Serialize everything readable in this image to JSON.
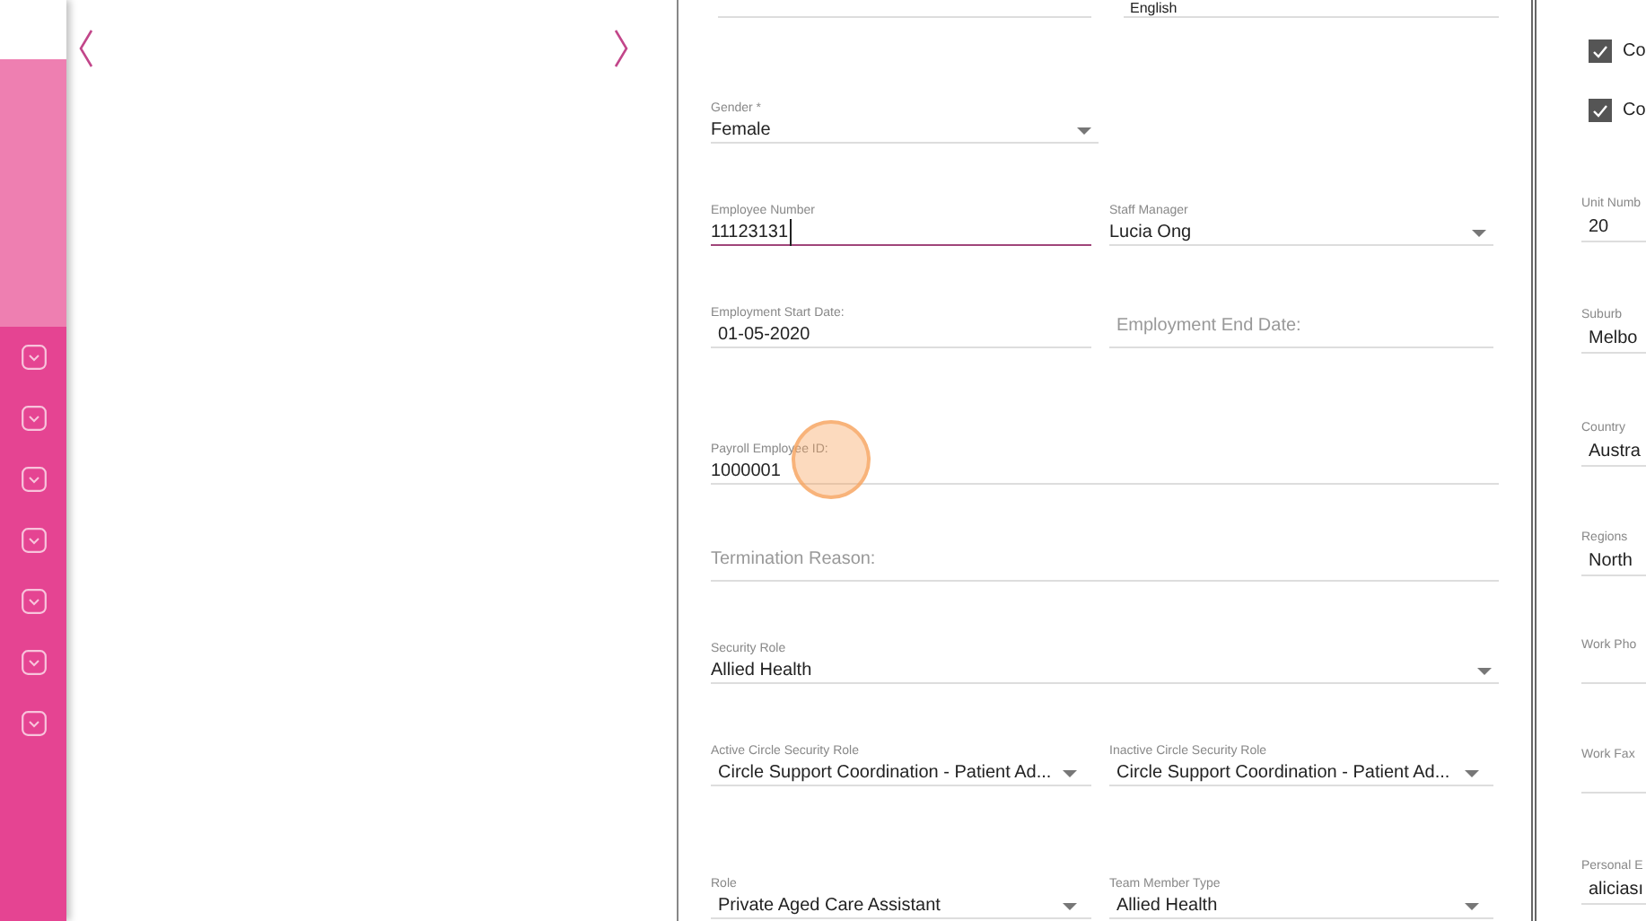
{
  "sidebar": {
    "items": [
      {
        "expanded": false
      },
      {
        "expanded": false
      },
      {
        "expanded": false
      },
      {
        "expanded": false
      },
      {
        "expanded": false
      },
      {
        "expanded": false
      },
      {
        "expanded": false
      }
    ]
  },
  "form": {
    "top_row_value": "English",
    "rows": [
      [
        {
          "kind": "select",
          "label": "Gender *",
          "value": "Female",
          "focused": false
        }
      ],
      [
        {
          "kind": "text",
          "label": "Employee Number",
          "value": "11123131",
          "focused": true
        },
        {
          "kind": "select",
          "label": "Staff Manager",
          "value": "Lucia Ong",
          "focused": false
        }
      ],
      [
        {
          "kind": "date",
          "label": "Employment Start Date:",
          "value": "01-05-2020",
          "focused": false
        },
        {
          "kind": "date",
          "placeholder": "Employment End Date:",
          "focused": false
        }
      ],
      [
        {
          "kind": "text",
          "label": "Payroll Employee ID:",
          "value": "1000001",
          "focused": false
        }
      ],
      [
        {
          "kind": "text",
          "placeholder": "Termination Reason:",
          "focused": false
        }
      ],
      [
        {
          "kind": "select",
          "label": "Security Role",
          "value": "Allied Health",
          "focused": false
        }
      ],
      [
        {
          "kind": "select",
          "label": "Active Circle Security Role",
          "value": "Circle Support Coordination - Patient Ad...",
          "focused": false
        },
        {
          "kind": "select",
          "label": "Inactive Circle Security Role",
          "value": "Circle Support Coordination - Patient Ad...",
          "focused": false
        }
      ],
      [
        {
          "kind": "select",
          "label": "Role",
          "value": "Private Aged Care Assistant",
          "focused": false
        },
        {
          "kind": "select",
          "label": "Team Member Type",
          "value": "Allied Health",
          "focused": false
        }
      ]
    ]
  },
  "right_panel": [
    {
      "kind": "checkbox",
      "label": "Co",
      "checked": true
    },
    {
      "kind": "checkbox",
      "label": "Co",
      "checked": true
    },
    {
      "kind": "field",
      "label": "Unit Numb",
      "value": "20"
    },
    {
      "kind": "field",
      "label": "Suburb",
      "value": "Melbo"
    },
    {
      "kind": "field",
      "label": "Country",
      "value": "Austra"
    },
    {
      "kind": "field",
      "label": "Regions",
      "value": "North"
    },
    {
      "kind": "field",
      "label": "Work Pho"
    },
    {
      "kind": "field",
      "label": "Work Fax"
    },
    {
      "kind": "field",
      "label": "Personal E",
      "value": "aliciası"
    }
  ]
}
